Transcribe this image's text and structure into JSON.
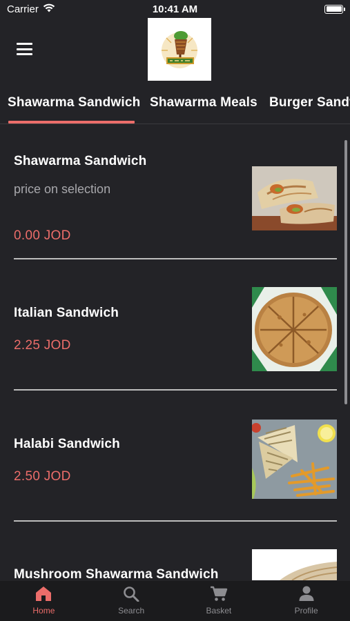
{
  "status_bar": {
    "carrier": "Carrier",
    "time": "10:41 AM"
  },
  "header": {
    "menu_icon": "hamburger-menu-icon",
    "logo": "restaurant-logo"
  },
  "tabs": [
    {
      "label": "Shawarma Sandwich",
      "active": true
    },
    {
      "label": "Shawarma Meals",
      "active": false
    },
    {
      "label": "Burger Sandwiches",
      "active": false
    }
  ],
  "items": [
    {
      "name": "Shawarma Sandwich",
      "subtitle": "price on selection",
      "price": "0.00 JOD"
    },
    {
      "name": "Italian Sandwich",
      "price": "2.25 JOD"
    },
    {
      "name": "Halabi Sandwich",
      "price": "2.50 JOD"
    },
    {
      "name": "Mushroom Shawarma Sandwich"
    }
  ],
  "bottom_nav": [
    {
      "label": "Home",
      "icon": "home-icon",
      "active": true
    },
    {
      "label": "Search",
      "icon": "search-icon",
      "active": false
    },
    {
      "label": "Basket",
      "icon": "cart-icon",
      "active": false
    },
    {
      "label": "Profile",
      "icon": "profile-icon",
      "active": false
    }
  ],
  "colors": {
    "accent": "#ec6d6a",
    "background": "#232327",
    "nav_background": "#1b1b1d",
    "muted_text": "#a8a8ac"
  }
}
